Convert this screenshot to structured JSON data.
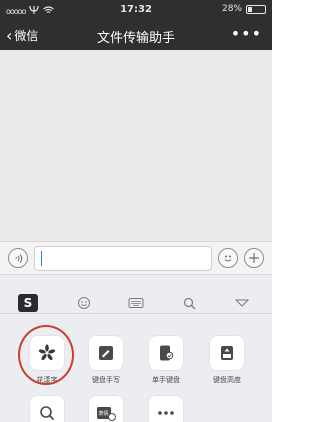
{
  "status_bar": {
    "signal": "ooooo",
    "carrier_icon": "psi-icon",
    "time": "17:32",
    "battery_percent": "28%",
    "battery_level": 0.28
  },
  "nav": {
    "back_label": "微信",
    "title": "文件传输助手",
    "more_label": "•••"
  },
  "input_bar": {
    "voice_icon": "voice-icon",
    "emoji_icon": "emoji-icon",
    "plus_icon": "plus-icon"
  },
  "keyboard": {
    "toolbar": {
      "logo": "S",
      "items": [
        "emoji-face-icon",
        "keyboard-icon",
        "search-icon",
        "hide-keyboard-icon"
      ]
    },
    "tiles": [
      {
        "label": "花漾字",
        "icon": "flower-icon"
      },
      {
        "label": "键盘手写",
        "icon": "handwriting-icon"
      },
      {
        "label": "单手键盘",
        "icon": "one-hand-icon"
      },
      {
        "label": "键盘高度",
        "icon": "keyboard-height-icon"
      }
    ],
    "second_row_icons": [
      "search-icon",
      "clipboard-icon",
      "more-icon"
    ],
    "second_row_tile2_text": "表情"
  },
  "annotation_color": "#c8412f"
}
